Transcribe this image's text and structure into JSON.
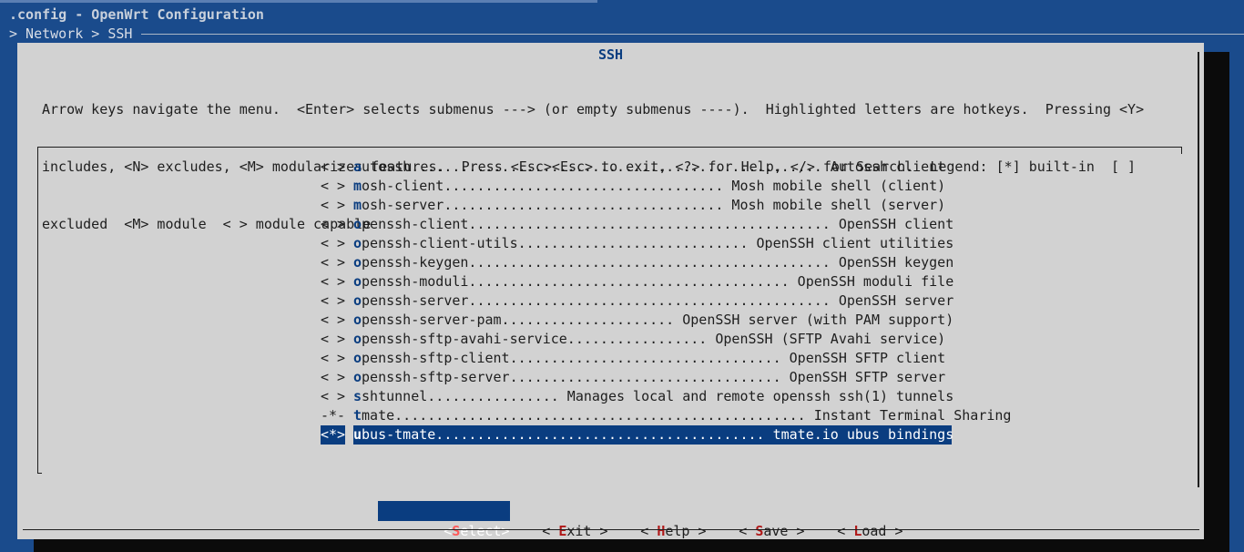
{
  "window": {
    "title": ".config - OpenWrt Configuration",
    "breadcrumb": "> Network > SSH"
  },
  "dialog": {
    "title": "SSH",
    "help_lines": [
      "Arrow keys navigate the menu.  <Enter> selects submenus ---> (or empty submenus ----).  Highlighted letters are hotkeys.  Pressing <Y>",
      "includes, <N> excludes, <M> modularizes features.  Press <Esc><Esc> to exit, <?> for Help, </> for Search.  Legend: [*] built-in  [ ]",
      "excluded  <M> module  < > module capable"
    ]
  },
  "menu": {
    "items": [
      {
        "prefix": "< >",
        "hotkey": "a",
        "rest": "utossh.................................................. Autossh client"
      },
      {
        "prefix": "< >",
        "hotkey": "m",
        "rest": "osh-client.................................. Mosh mobile shell (client)"
      },
      {
        "prefix": "< >",
        "hotkey": "m",
        "rest": "osh-server.................................. Mosh mobile shell (server)"
      },
      {
        "prefix": "< >",
        "hotkey": "o",
        "rest": "penssh-client............................................ OpenSSH client"
      },
      {
        "prefix": "< >",
        "hotkey": "o",
        "rest": "penssh-client-utils............................ OpenSSH client utilities"
      },
      {
        "prefix": "< >",
        "hotkey": "o",
        "rest": "penssh-keygen............................................ OpenSSH keygen"
      },
      {
        "prefix": "< >",
        "hotkey": "o",
        "rest": "penssh-moduli....................................... OpenSSH moduli file"
      },
      {
        "prefix": "< >",
        "hotkey": "o",
        "rest": "penssh-server............................................ OpenSSH server"
      },
      {
        "prefix": "< >",
        "hotkey": "o",
        "rest": "penssh-server-pam..................... OpenSSH server (with PAM support)"
      },
      {
        "prefix": "< >",
        "hotkey": "o",
        "rest": "penssh-sftp-avahi-service................. OpenSSH (SFTP Avahi service)"
      },
      {
        "prefix": "< >",
        "hotkey": "o",
        "rest": "penssh-sftp-client................................. OpenSSH SFTP client"
      },
      {
        "prefix": "< >",
        "hotkey": "o",
        "rest": "penssh-sftp-server................................. OpenSSH SFTP server"
      },
      {
        "prefix": "< >",
        "hotkey": "s",
        "rest": "shtunnel................ Manages local and remote openssh ssh(1) tunnels"
      },
      {
        "prefix": "-*-",
        "hotkey": "t",
        "rest": "mate.................................................. Instant Terminal Sharing"
      },
      {
        "prefix": "<*>",
        "hotkey": "u",
        "rest": "bus-tmate........................................ tmate.io ubus bindings"
      }
    ],
    "selected_index": 14
  },
  "buttons": [
    {
      "open": "<",
      "hotkey": "S",
      "rest": "elect",
      "close": ">",
      "active": true
    },
    {
      "open": "< ",
      "hotkey": "E",
      "rest": "xit",
      "close": " >",
      "active": false
    },
    {
      "open": "< ",
      "hotkey": "H",
      "rest": "elp",
      "close": " >",
      "active": false
    },
    {
      "open": "< ",
      "hotkey": "S",
      "rest": "ave",
      "close": " >",
      "active": false
    },
    {
      "open": "< ",
      "hotkey": "L",
      "rest": "oad",
      "close": " >",
      "active": false
    }
  ],
  "colors": {
    "background": "#1a4b8c",
    "dialog": "#d2d2d2",
    "highlight": "#0a3d80",
    "hotkey_button": "#b01818"
  }
}
